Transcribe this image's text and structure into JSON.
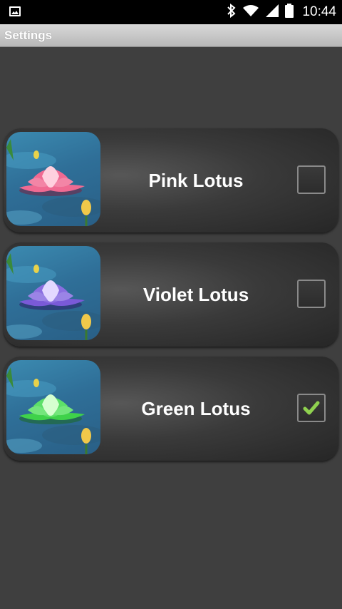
{
  "status_bar": {
    "time": "10:44",
    "icons": [
      "image-notification-icon",
      "bluetooth-icon",
      "wifi-icon",
      "signal-icon",
      "battery-icon"
    ]
  },
  "title_bar": {
    "title": "Settings"
  },
  "items": [
    {
      "label": "Pink Lotus",
      "checked": false,
      "flower_color": "#f06a92",
      "flower_inner": "#ffd0de"
    },
    {
      "label": "Violet Lotus",
      "checked": false,
      "flower_color": "#7a5ad8",
      "flower_inner": "#e3d8ff"
    },
    {
      "label": "Green Lotus",
      "checked": true,
      "flower_color": "#3fd24a",
      "flower_inner": "#d6ffd0"
    }
  ],
  "colors": {
    "background": "#3f3f3f",
    "check_mark": "#8fd14f"
  }
}
